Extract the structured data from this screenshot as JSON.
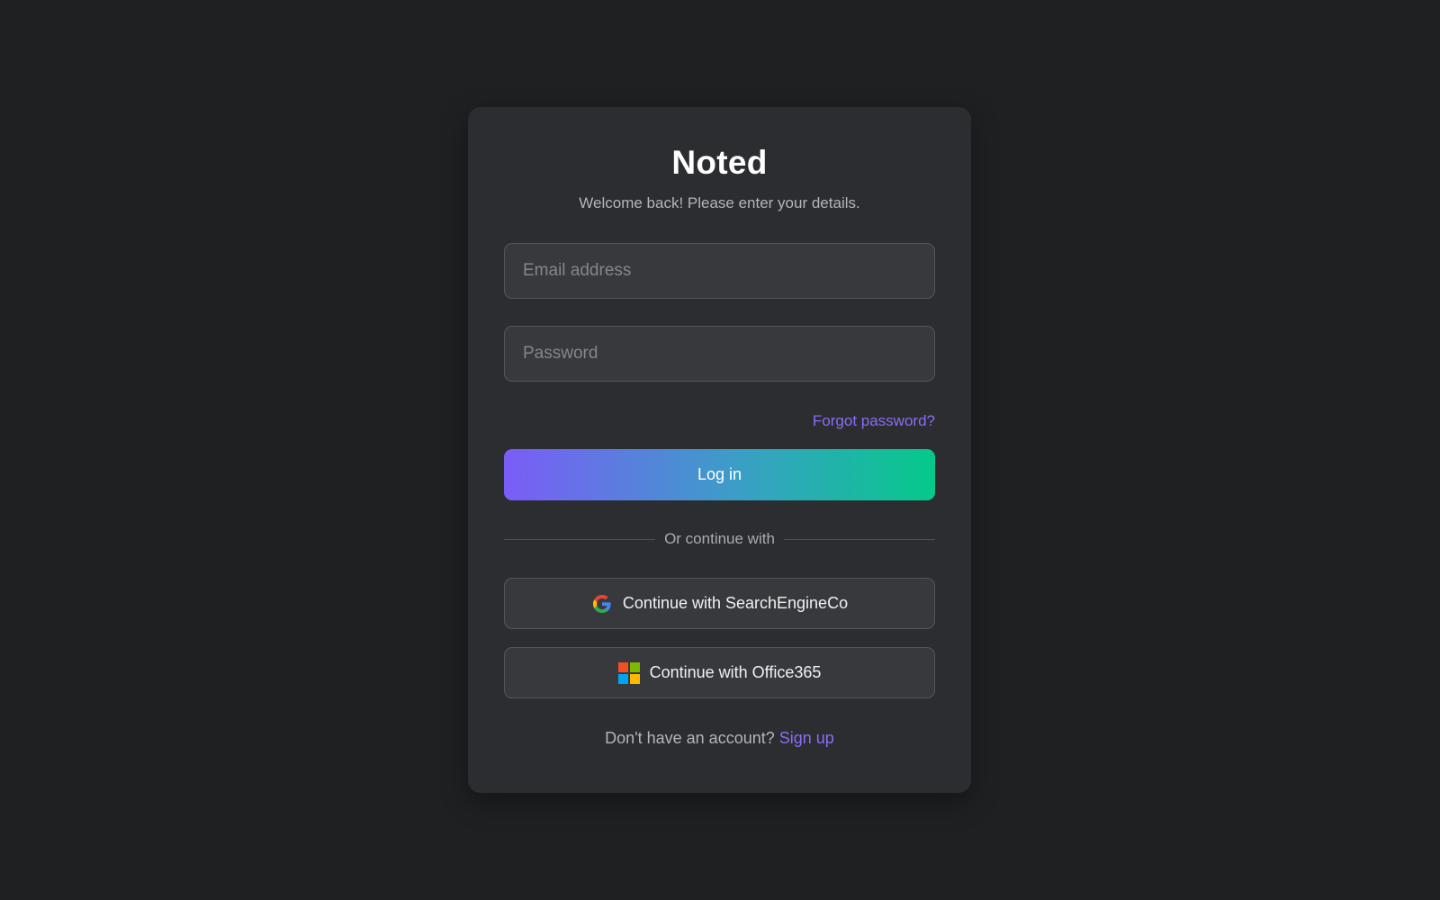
{
  "app": {
    "title": "Noted",
    "subtitle": "Welcome back! Please enter your details."
  },
  "form": {
    "email_placeholder": "Email address",
    "email_value": "",
    "password_placeholder": "Password",
    "password_value": "",
    "forgot_label": "Forgot password?",
    "login_label": "Log in"
  },
  "divider": {
    "label": "Or continue with"
  },
  "oauth": {
    "search_label": "Continue with SearchEngineCo",
    "office_label": "Continue with Office365"
  },
  "footer": {
    "prompt": "Don't have an account?",
    "signup_label": "Sign up"
  },
  "colors": {
    "background": "#1f2022",
    "card": "#2c2d30",
    "accent": "#8b6cf6",
    "gradient_start": "#7b5cf7",
    "gradient_end": "#05c98a"
  }
}
